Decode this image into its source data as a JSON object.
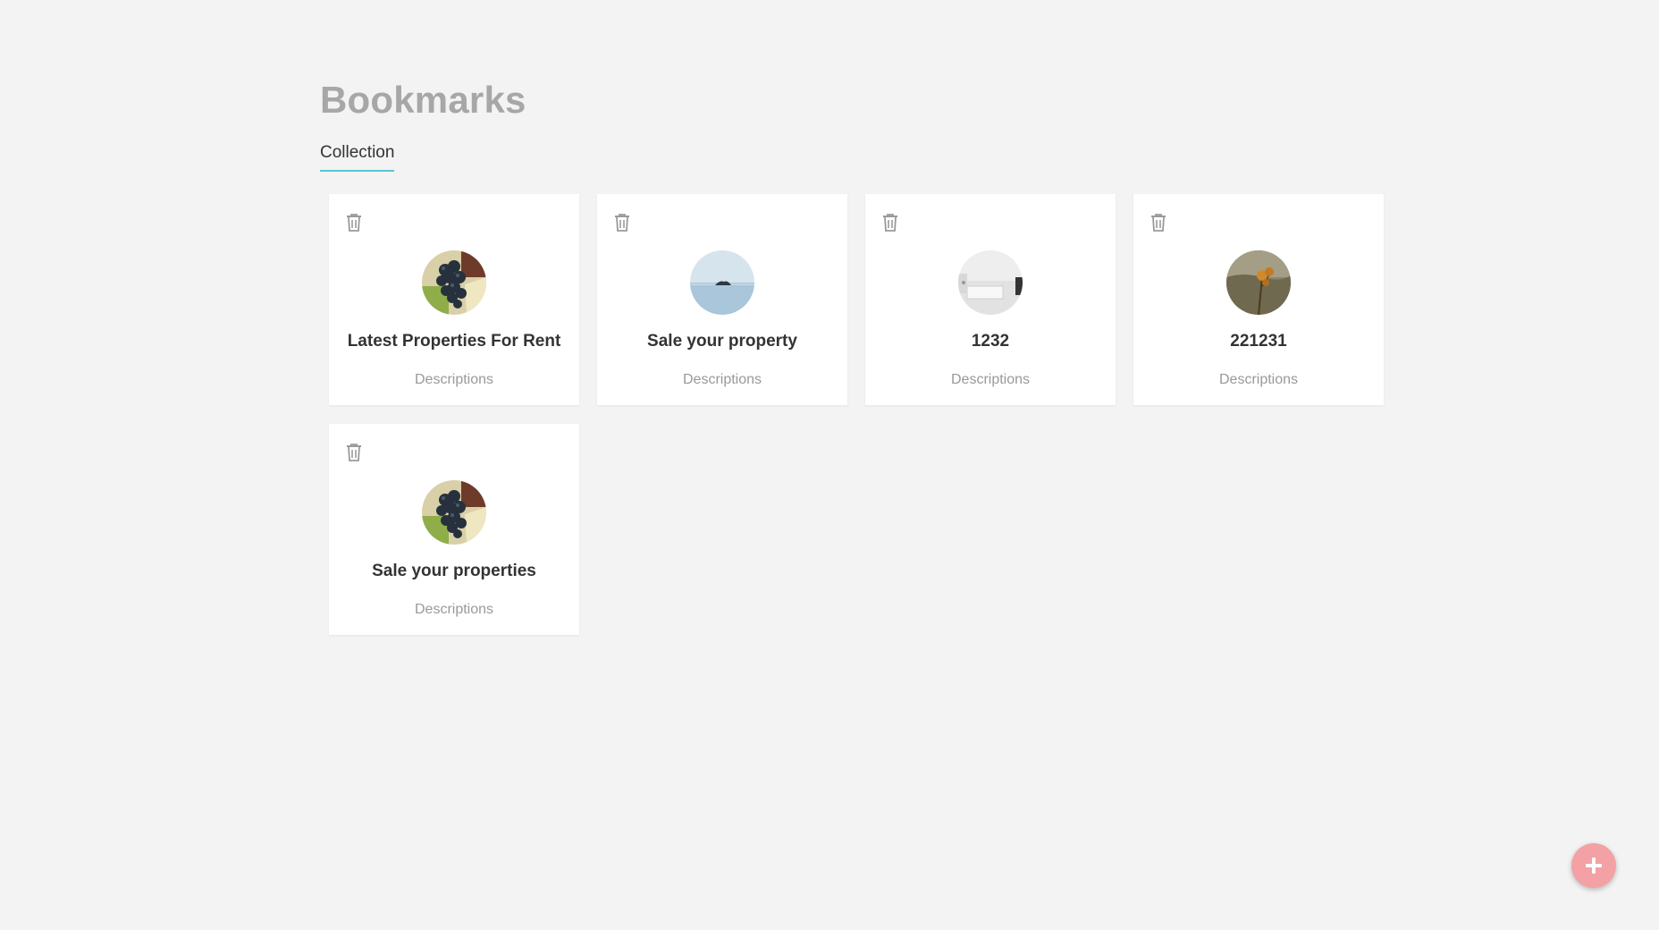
{
  "page": {
    "title": "Bookmarks"
  },
  "tabs": [
    {
      "label": "Collection",
      "active": true
    }
  ],
  "cards": [
    {
      "title": "Latest Properties For Rent",
      "description": "Descriptions",
      "image": "grapes"
    },
    {
      "title": "Sale your property",
      "description": "Descriptions",
      "image": "sea-island"
    },
    {
      "title": "1232",
      "description": "Descriptions",
      "image": "white-room"
    },
    {
      "title": "221231",
      "description": "Descriptions",
      "image": "dry-flowers"
    },
    {
      "title": "Sale your properties",
      "description": "Descriptions",
      "image": "grapes"
    }
  ],
  "fab": {
    "icon": "plus-icon"
  },
  "colors": {
    "background": "#f3f3f3",
    "title": "#a7a7a7",
    "tab_underline": "#58c4d6",
    "fab": "#f3a1a4"
  }
}
